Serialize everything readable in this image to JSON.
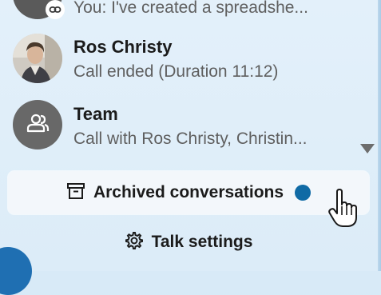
{
  "conversations": [
    {
      "name": "",
      "preview": "You: I've created a spreadshe...",
      "avatar": "user-avatar-partial",
      "badge_icon": "link-icon"
    },
    {
      "name": "Ros Christy",
      "preview": "Call ended (Duration 11:12)",
      "avatar": "photo-avatar"
    },
    {
      "name": "Team",
      "preview": "Call with Ros Christy, Christin...",
      "avatar": "group-icon"
    }
  ],
  "archived": {
    "label": "Archived conversations",
    "icon": "archive-box-icon",
    "unread_dot_color": "#0f6aa5"
  },
  "settings": {
    "label": "Talk settings",
    "icon": "gear-icon"
  },
  "scroll_indicator": "chevron-down-icon",
  "colors": {
    "panel_bg": "#dcecf8",
    "button_bg": "#f3f7fb",
    "text_primary": "#1b1b1b",
    "text_secondary": "#5f5f5f",
    "accent": "#0f6aa5"
  }
}
